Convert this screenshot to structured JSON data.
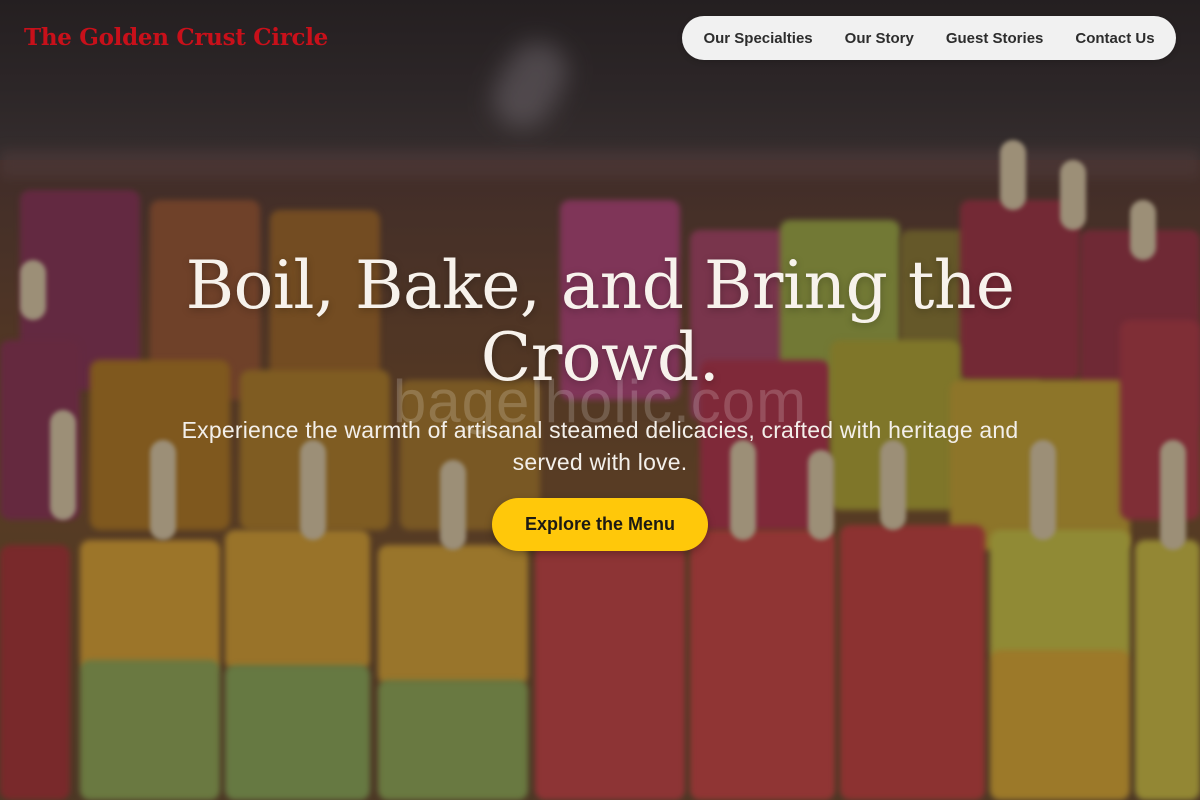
{
  "header": {
    "logo": "The Golden Crust Circle",
    "nav": [
      {
        "label": "Our Specialties"
      },
      {
        "label": "Our Story"
      },
      {
        "label": "Guest Stories"
      },
      {
        "label": "Contact Us"
      }
    ]
  },
  "hero": {
    "headline": "Boil, Bake, and Bring the Crowd.",
    "subtitle": "Experience the warmth of artisanal steamed delicacies, crafted with heritage and served with love.",
    "cta_label": "Explore the Menu",
    "watermark": "bagelholic.com"
  },
  "colors": {
    "logo": "#c8101a",
    "nav_background": "#f1f1f1",
    "cta_background": "#ffc80a",
    "headline": "#f7f2ec"
  },
  "background_image": "blurred photo of rows of colorful ice pops on sticks"
}
